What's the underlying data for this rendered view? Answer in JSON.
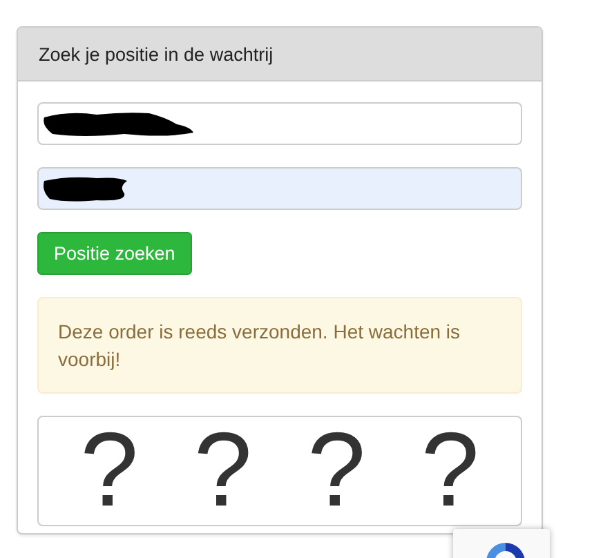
{
  "panel": {
    "title": "Zoek je positie in de wachtrij"
  },
  "fields": [
    {
      "redacted": true,
      "autofilled": false
    },
    {
      "redacted": true,
      "autofilled": true
    }
  ],
  "button": {
    "label": "Positie zoeken"
  },
  "alert": {
    "text": "Deze order is reeds verzonden. Het wachten is voorbij!"
  },
  "positions": [
    "?",
    "?",
    "?",
    "?"
  ]
}
